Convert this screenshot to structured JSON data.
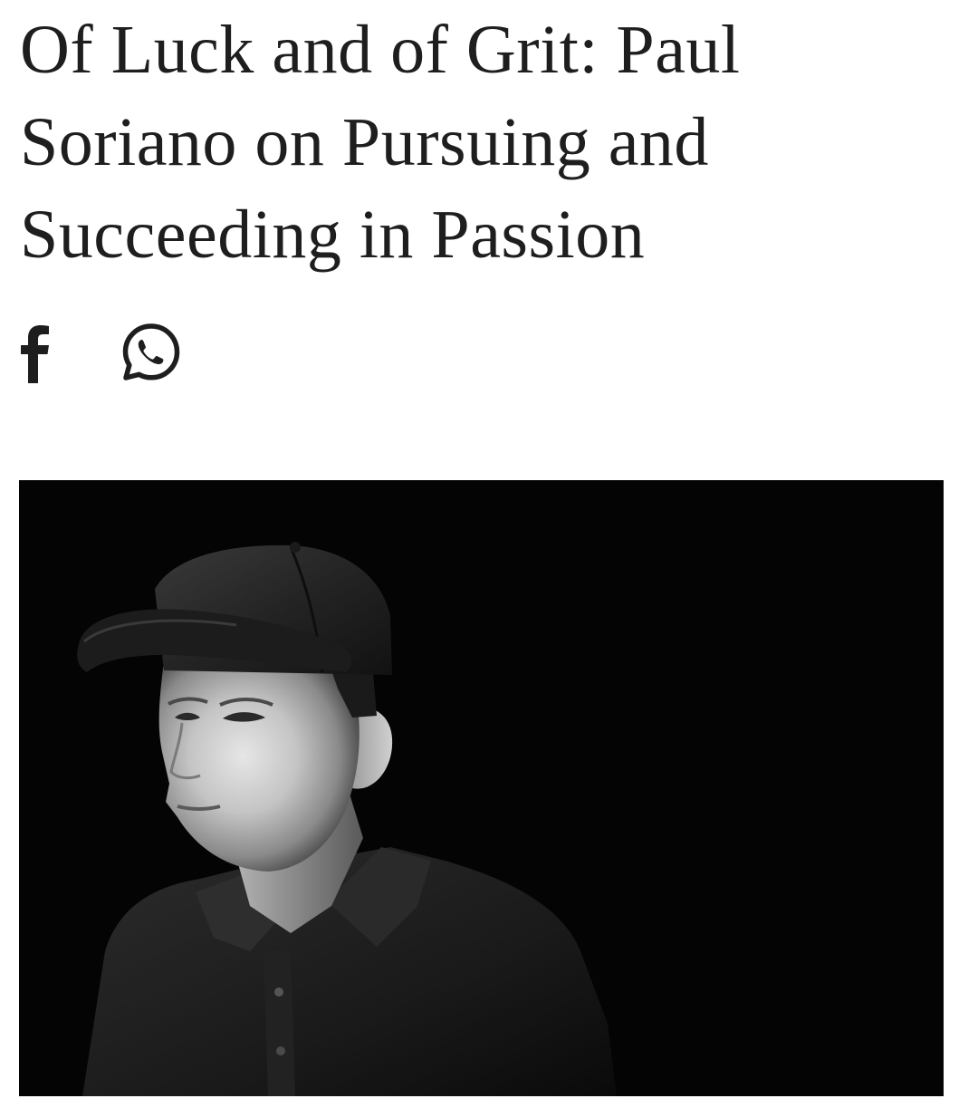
{
  "article": {
    "title": "Of Luck and of Grit: Paul Soriano on Pursuing and Succeeding in Passion"
  },
  "share": {
    "buttons": [
      {
        "icon": "facebook-icon"
      },
      {
        "icon": "whatsapp-icon"
      }
    ]
  },
  "photo": {
    "style": "black-and-white portrait"
  },
  "colors": {
    "text": "#1e1e1e",
    "background": "#ffffff",
    "photo_background": "#040404"
  }
}
